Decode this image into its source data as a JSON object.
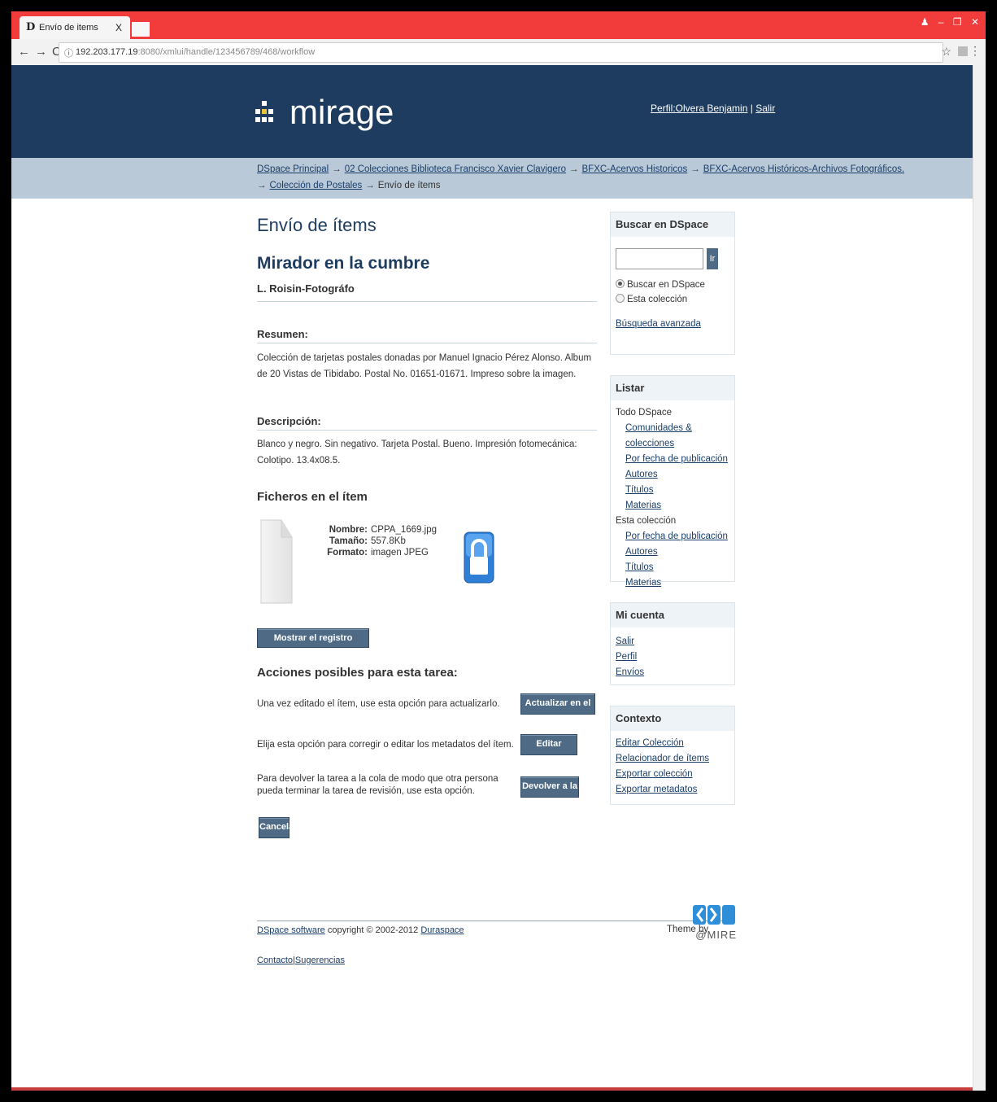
{
  "browser": {
    "tab_title": "Envío de items",
    "tab_close": "X",
    "url_main": "192.203.177.19",
    "url_rest": ":8080/xmlui/handle/123456789/468/workflow"
  },
  "header": {
    "logo_text": "mirage",
    "profile_link": "Perfil:Olvera Benjamin",
    "divider": "|",
    "logout_link": "Salir"
  },
  "breadcrumb": {
    "items": [
      "DSpace Principal",
      "02 Colecciones Biblioteca Francisco Xavier Clavigero",
      "BFXC-Acervos Historicos",
      "BFXC-Acervos Históricos-Archivos Fotográficos.",
      "Colección de Postales"
    ],
    "current": "Envío de ítems",
    "arrow": "→"
  },
  "main": {
    "page_title": "Envío de ítems",
    "item_title": "Mirador en la cumbre",
    "item_author": "L. Roisin-Fotográfo",
    "resumen_label": "Resumen:",
    "resumen_text": "Colección de tarjetas postales donadas por Manuel Ignacio Pérez Alonso. Album de 20 Vistas de Tibidabo. Postal No. 01651-01671. Impreso sobre la imagen.",
    "descripcion_label": "Descripción:",
    "descripcion_text": "Blanco y negro. Sin negativo. Tarjeta Postal. Bueno. Impresión fotomecánica: Colotipo. 13.4x08.5.",
    "files_heading": "Ficheros en el ítem",
    "file": {
      "name_label": "Nombre:",
      "name_value": "CPPA_1669.jpg",
      "size_label": "Tamaño:",
      "size_value": "557.8Kb",
      "format_label": "Formato:",
      "format_value": "imagen JPEG"
    },
    "show_full_button": "Mostrar el registro completo del ítem",
    "actions_heading": "Acciones posibles para esta tarea:",
    "actions": [
      {
        "text": "Una vez editado el ítem, use esta opción para actualizarlo.",
        "button": "Actualizar en el archivo"
      },
      {
        "text": "Elija esta opción para corregir o editar los metadatos del ítem.",
        "button": "Editar metadatos"
      },
      {
        "text": "Para devolver la tarea a la cola de modo que otra persona pueda terminar la tarea de revisión, use esta opción.",
        "button": "Devolver a la cola"
      }
    ],
    "cancel_button": "Cancelar"
  },
  "sidebar": {
    "search": {
      "title": "Buscar en DSpace",
      "go_button": "Ir",
      "radio_all": "Buscar en DSpace",
      "radio_collection": "Esta colección",
      "advanced_link": "Búsqueda avanzada"
    },
    "browse": {
      "title": "Listar",
      "all_label": "Todo DSpace",
      "all_links": [
        "Comunidades & colecciones",
        "Por fecha de publicación",
        "Autores",
        "Títulos",
        "Materias"
      ],
      "collection_label": "Esta colección",
      "collection_links": [
        "Por fecha de publicación",
        "Autores",
        "Títulos",
        "Materias"
      ]
    },
    "account": {
      "title": "Mi cuenta",
      "links": [
        "Salir",
        "Perfil",
        "Envíos"
      ]
    },
    "context": {
      "title": "Contexto",
      "links": [
        "Editar Colección",
        "Relacionador de ítems",
        "Exportar colección",
        "Exportar metadatos"
      ]
    }
  },
  "footer": {
    "dspace_link": "DSpace software",
    "copyright": "copyright © 2002-2012",
    "duraspace_link": "Duraspace",
    "contact_link": "Contacto",
    "divider": "|",
    "feedback_link": "Sugerencias",
    "theme_by": "Theme by",
    "atmire_text": "@MIRE"
  },
  "colors": {
    "header_bg": "#1d3c5f",
    "breadcrumb_bg": "#b9c9d8",
    "button_bg": "#4f6a85",
    "tabstrip": "#f23b3b"
  }
}
